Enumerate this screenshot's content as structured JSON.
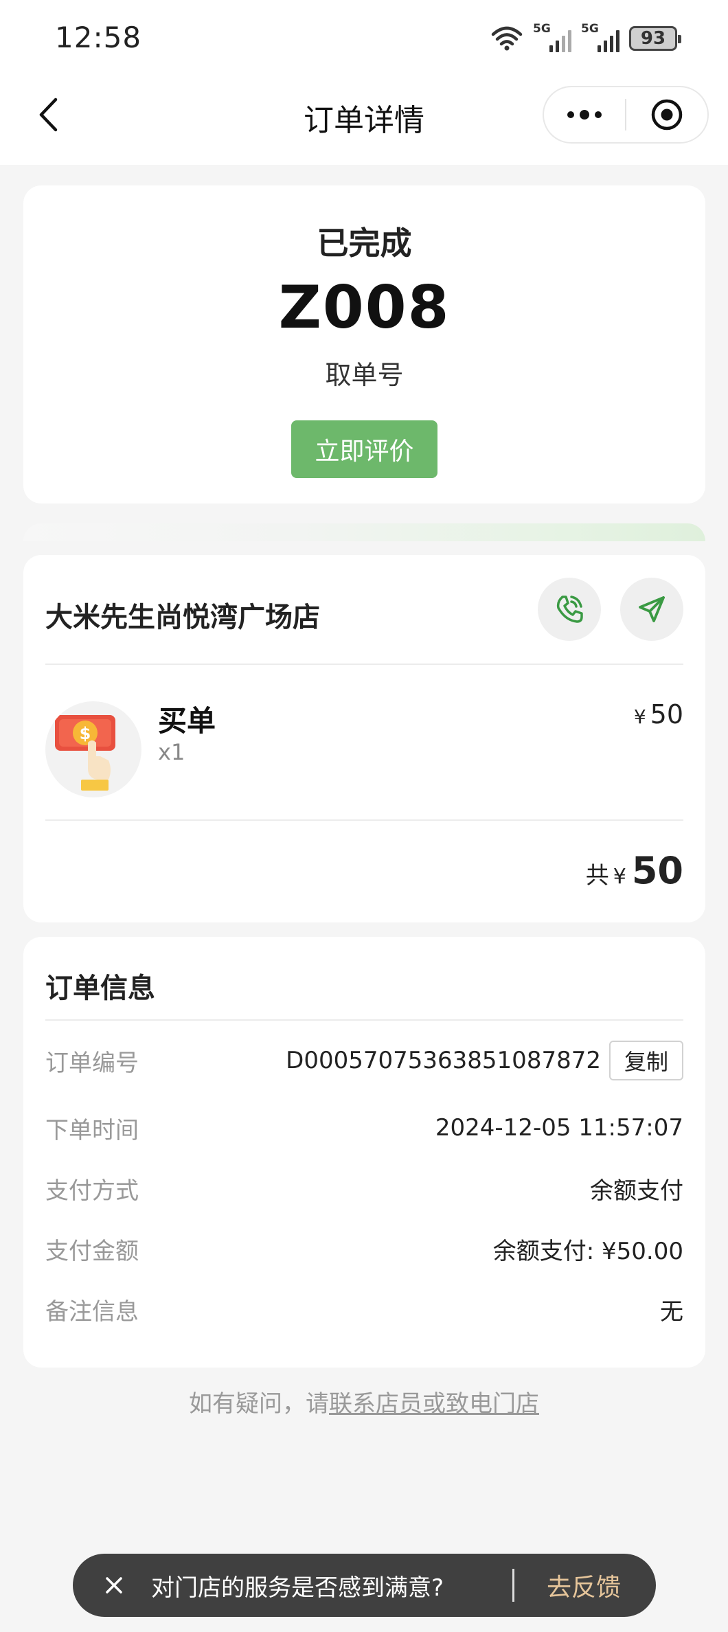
{
  "status_bar": {
    "time": "12:58",
    "network_1": "5G",
    "network_2": "5G",
    "battery": "93"
  },
  "nav": {
    "title": "订单详情",
    "back_icon": "chevron-left-icon",
    "more_icon": "more-dots-icon",
    "close_icon": "target-circle-icon"
  },
  "order_status": {
    "status": "已完成",
    "pickup_number": "Z008",
    "pickup_label": "取单号",
    "review_button": "立即评价",
    "button_color": "#6db86b"
  },
  "store": {
    "name": "大米先生尚悦湾广场店",
    "phone_icon": "phone-icon",
    "navigate_icon": "navigate-arrow-icon",
    "items": [
      {
        "name": "买单",
        "qty": "x1",
        "currency": "¥",
        "price": "50",
        "image_icon": "pay-bill-icon"
      }
    ],
    "total_label": "共",
    "total_currency": "¥",
    "total_amount": "50"
  },
  "order_info": {
    "title": "订单信息",
    "rows": [
      {
        "label": "订单编号",
        "value": "D00057075363851087872"
      },
      {
        "label": "下单时间",
        "value": "2024-12-05 11:57:07"
      },
      {
        "label": "支付方式",
        "value": "余额支付"
      },
      {
        "label": "支付金额",
        "value": "余额支付: ¥50.00"
      },
      {
        "label": "备注信息",
        "value": "无"
      }
    ],
    "copy_button": "复制"
  },
  "help": {
    "prefix": "如有疑问，请",
    "link": "联系店员或致电门店"
  },
  "feedback": {
    "question": "对门店的服务是否感到满意?",
    "action": "去反馈",
    "close_icon": "close-icon",
    "action_color": "#e6c59a"
  }
}
